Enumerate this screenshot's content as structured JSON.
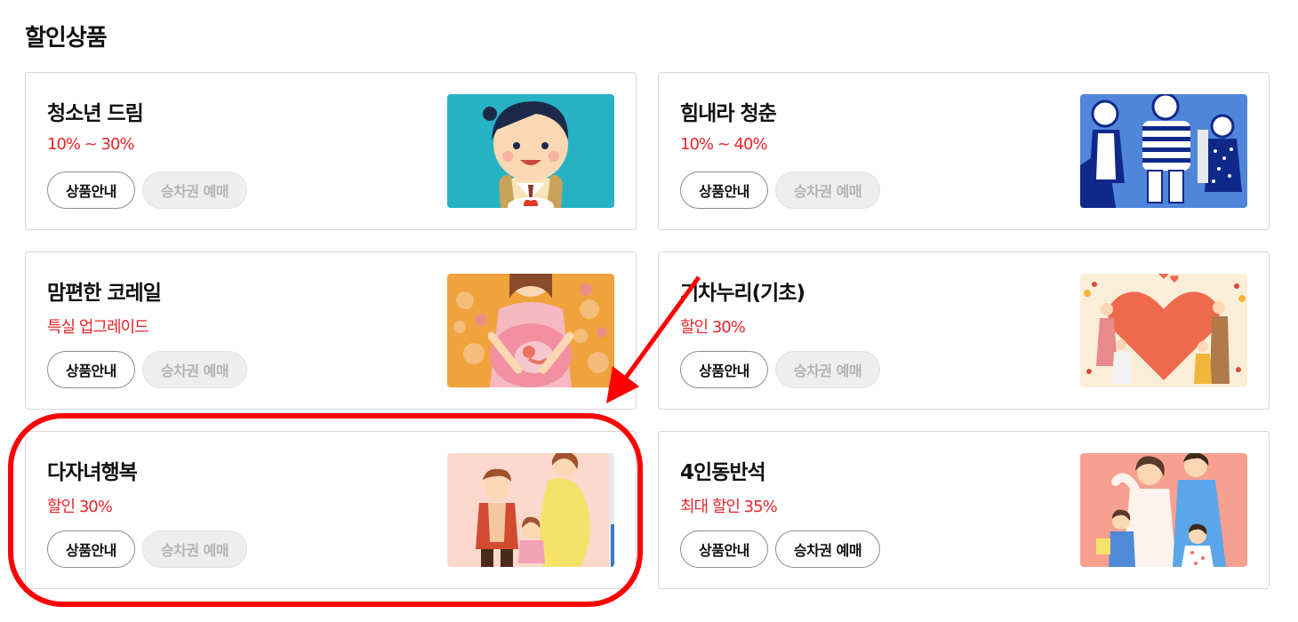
{
  "section": {
    "title": "할인상품"
  },
  "cards": [
    {
      "title": "청소년 드림",
      "discount": "10% ~ 30%",
      "info_label": "상품안내",
      "ticket_label": "승차권 예매",
      "ticket_enabled": false,
      "image": "teen-illustration"
    },
    {
      "title": "힘내라 청춘",
      "discount": "10% ~ 40%",
      "info_label": "상품안내",
      "ticket_label": "승차권 예매",
      "ticket_enabled": false,
      "image": "youth-group-illustration"
    },
    {
      "title": "맘편한 코레일",
      "discount": "특실 업그레이드",
      "info_label": "상품안내",
      "ticket_label": "승차권 예매",
      "ticket_enabled": false,
      "image": "pregnant-mother-illustration"
    },
    {
      "title": "기차누리(기초)",
      "discount": "할인 30%",
      "info_label": "상품안내",
      "ticket_label": "승차권 예매",
      "ticket_enabled": false,
      "image": "heart-family-illustration"
    },
    {
      "title": "다자녀행복",
      "discount": "할인 30%",
      "info_label": "상품안내",
      "ticket_label": "승차권 예매",
      "ticket_enabled": false,
      "image": "multi-child-family-illustration"
    },
    {
      "title": "4인동반석",
      "discount": "최대 할인 35%",
      "info_label": "상품안내",
      "ticket_label": "승차권 예매",
      "ticket_enabled": true,
      "image": "family-of-four-illustration"
    }
  ],
  "colors": {
    "accent_red": "#e8252a",
    "border": "#d6d6d6",
    "disabled_bg": "#eeeeee",
    "disabled_text": "#b3b3b3",
    "annotation": "#ff0000"
  },
  "annotations": {
    "highlight": "red-rounded-rect-around-card-5",
    "arrow": "red-arrow-pointing-to-card-5"
  }
}
